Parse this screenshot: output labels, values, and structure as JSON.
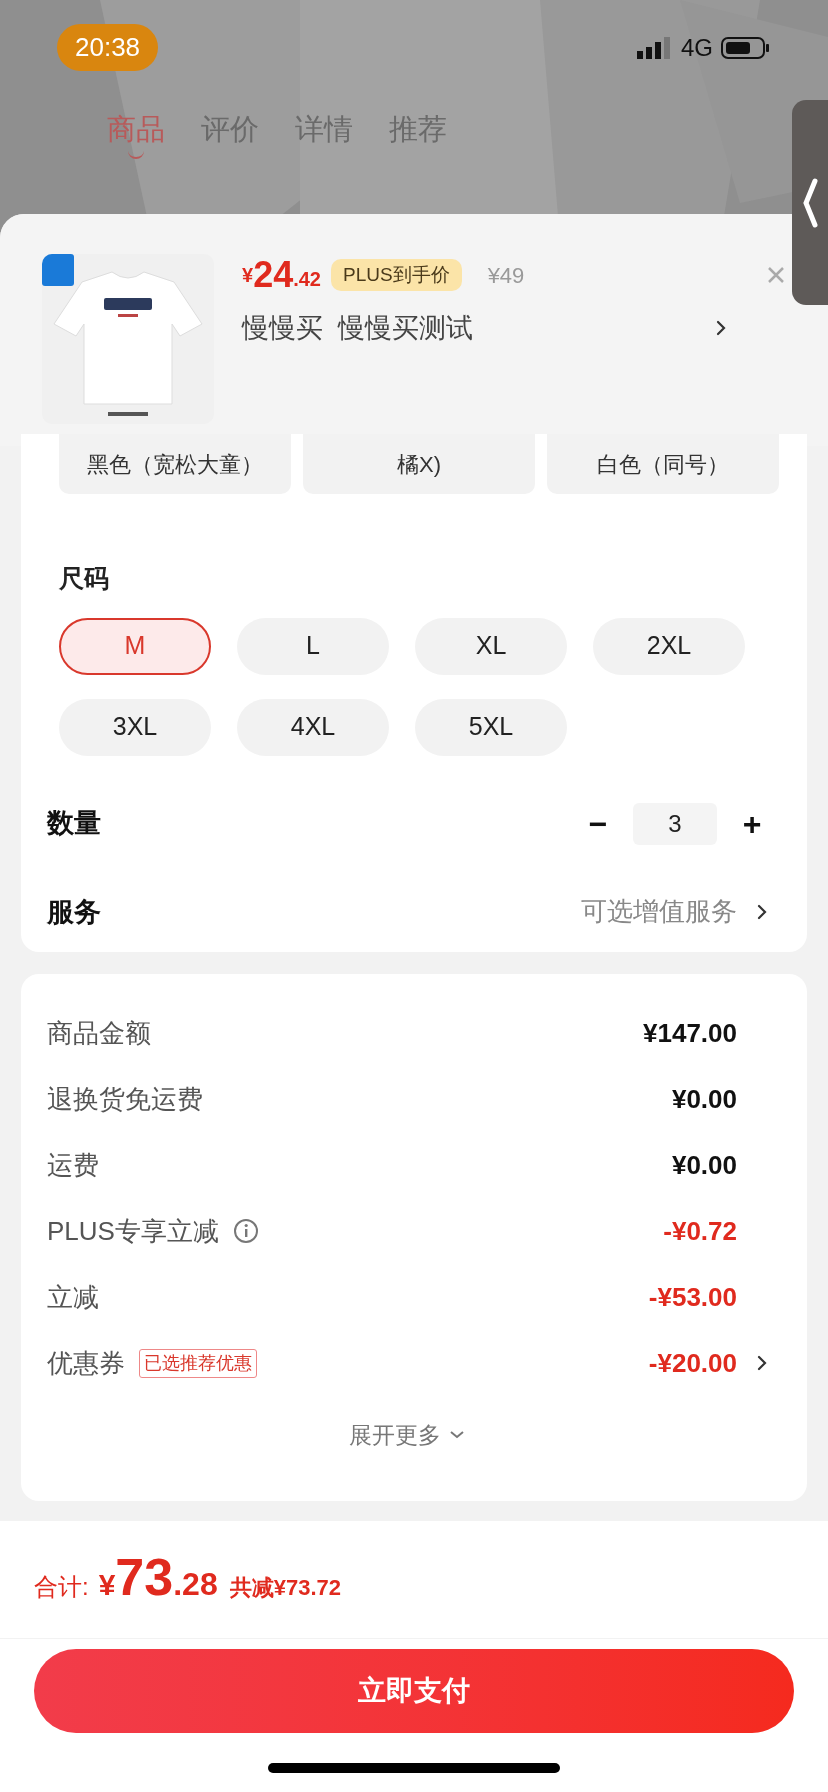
{
  "status_bar": {
    "time": "20:38",
    "network": "4G"
  },
  "tabs": [
    {
      "label": "商品",
      "selected": true
    },
    {
      "label": "评价",
      "selected": false
    },
    {
      "label": "详情",
      "selected": false
    },
    {
      "label": "推荐",
      "selected": false
    }
  ],
  "product": {
    "price_symbol": "¥",
    "price_int": "24",
    "price_dec": ".42",
    "badge": "PLUS到手价",
    "original_price": "¥49",
    "name": "慢慢买  慢慢买测试"
  },
  "colors": [
    {
      "label": "黑色（宽松大童）",
      "selected": false
    },
    {
      "label": "橘X)",
      "selected": false
    },
    {
      "label": "白色（同号）",
      "selected": false
    }
  ],
  "size": {
    "title": "尺码",
    "options": [
      {
        "label": "M",
        "selected": true
      },
      {
        "label": "L",
        "selected": false
      },
      {
        "label": "XL",
        "selected": false
      },
      {
        "label": "2XL",
        "selected": false
      },
      {
        "label": "3XL",
        "selected": false
      },
      {
        "label": "4XL",
        "selected": false
      },
      {
        "label": "5XL",
        "selected": false
      }
    ]
  },
  "quantity": {
    "label": "数量",
    "minus": "−",
    "value": "3",
    "plus": "+"
  },
  "service": {
    "label": "服务",
    "value": "可选增值服务"
  },
  "summary": [
    {
      "label": "商品金额",
      "value": "¥147.00",
      "kind": "plain"
    },
    {
      "label": "退换货免运费",
      "value": "¥0.00",
      "kind": "plain"
    },
    {
      "label": "运费",
      "value": "¥0.00",
      "kind": "plain"
    },
    {
      "label": "PLUS专享立减",
      "value": "-¥0.72",
      "kind": "info"
    },
    {
      "label": "立减",
      "value": "-¥53.00",
      "kind": "discount"
    },
    {
      "label": "优惠券",
      "value": "-¥20.00",
      "kind": "coupon",
      "tag": "已选推荐优惠"
    }
  ],
  "expand": "展开更多",
  "total": {
    "label": "合计:",
    "symbol": "¥",
    "int": "73",
    "dec": ".28",
    "saved": "共减¥73.72"
  },
  "pay_button": "立即支付"
}
